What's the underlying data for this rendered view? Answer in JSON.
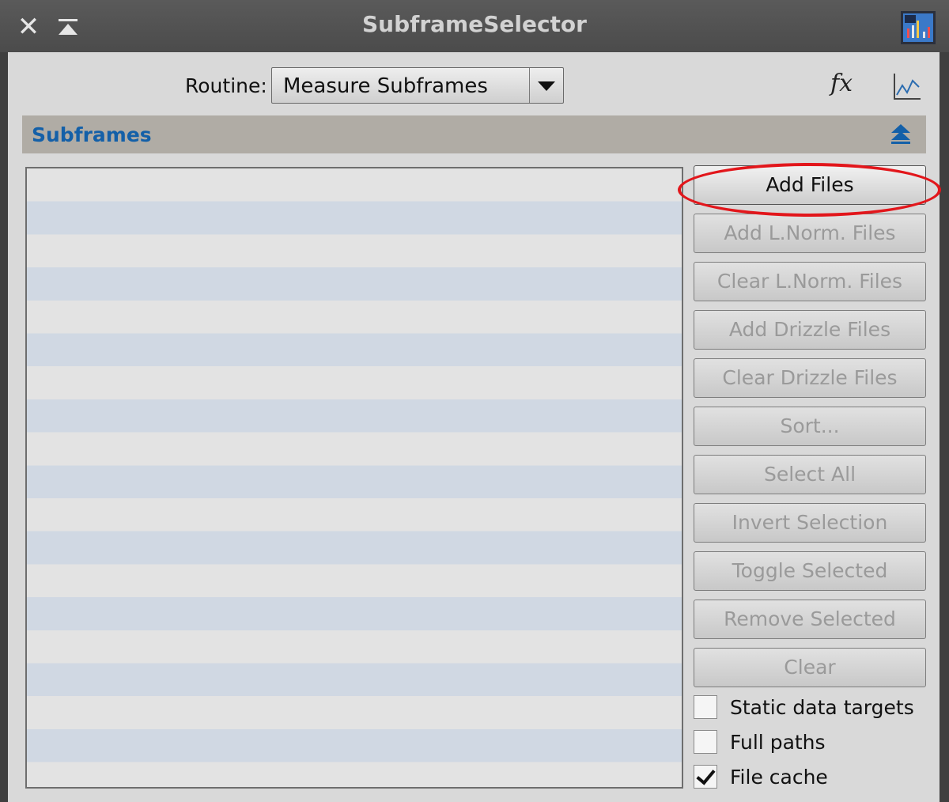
{
  "window": {
    "title": "SubframeSelector"
  },
  "toolbar": {
    "routine_label": "Routine:",
    "routine_value": "Measure Subframes"
  },
  "section": {
    "title": "Subframes"
  },
  "buttons": {
    "add_files": "Add Files",
    "add_lnorm": "Add L.Norm. Files",
    "clear_lnorm": "Clear L.Norm. Files",
    "add_drizzle": "Add Drizzle Files",
    "clear_drizzle": "Clear Drizzle Files",
    "sort": "Sort...",
    "select_all": "Select All",
    "invert_selection": "Invert Selection",
    "toggle_selected": "Toggle Selected",
    "remove_selected": "Remove Selected",
    "clear": "Clear"
  },
  "checkboxes": {
    "static_targets": {
      "label": "Static data targets",
      "checked": false
    },
    "full_paths": {
      "label": "Full paths",
      "checked": false
    },
    "file_cache": {
      "label": "File cache",
      "checked": true
    }
  },
  "icons": {
    "close": "close-icon",
    "shade": "shade-icon",
    "app": "app-icon",
    "fx": "fx-icon",
    "graph": "graph-icon",
    "collapse": "collapse-icon"
  },
  "colors": {
    "section_title": "#1460a8",
    "highlight_ring": "#e2161b",
    "list_row_alt": "#d0d8e3"
  },
  "fx_text": "fx"
}
